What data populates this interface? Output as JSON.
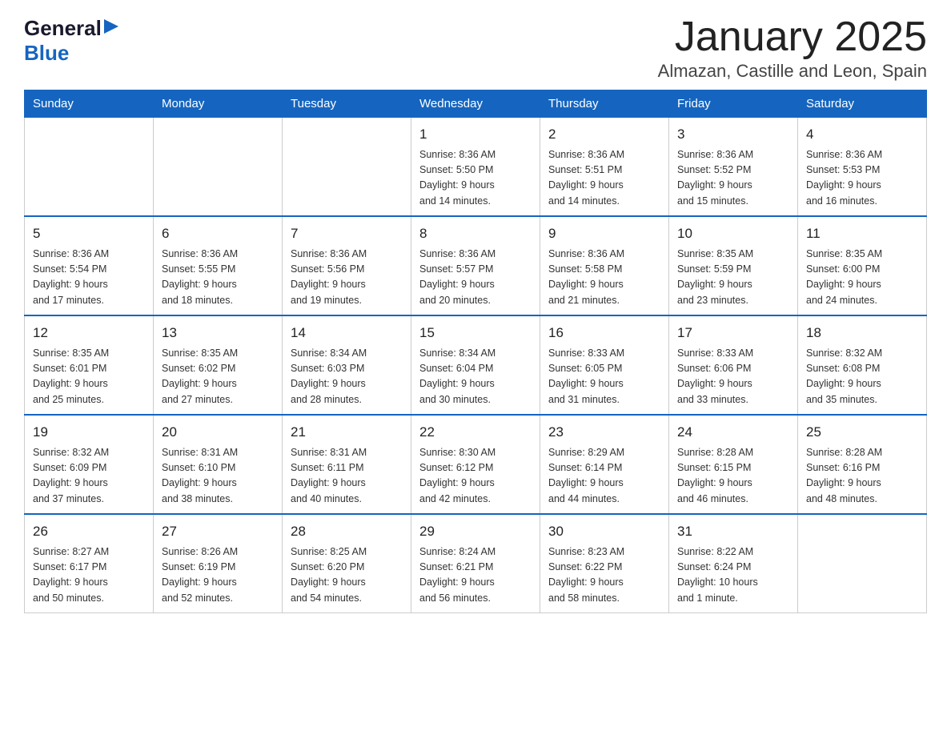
{
  "header": {
    "logo_general": "General",
    "logo_blue": "Blue",
    "month_title": "January 2025",
    "location": "Almazan, Castille and Leon, Spain"
  },
  "days_of_week": [
    "Sunday",
    "Monday",
    "Tuesday",
    "Wednesday",
    "Thursday",
    "Friday",
    "Saturday"
  ],
  "weeks": [
    [
      {
        "day": "",
        "info": ""
      },
      {
        "day": "",
        "info": ""
      },
      {
        "day": "",
        "info": ""
      },
      {
        "day": "1",
        "info": "Sunrise: 8:36 AM\nSunset: 5:50 PM\nDaylight: 9 hours\nand 14 minutes."
      },
      {
        "day": "2",
        "info": "Sunrise: 8:36 AM\nSunset: 5:51 PM\nDaylight: 9 hours\nand 14 minutes."
      },
      {
        "day": "3",
        "info": "Sunrise: 8:36 AM\nSunset: 5:52 PM\nDaylight: 9 hours\nand 15 minutes."
      },
      {
        "day": "4",
        "info": "Sunrise: 8:36 AM\nSunset: 5:53 PM\nDaylight: 9 hours\nand 16 minutes."
      }
    ],
    [
      {
        "day": "5",
        "info": "Sunrise: 8:36 AM\nSunset: 5:54 PM\nDaylight: 9 hours\nand 17 minutes."
      },
      {
        "day": "6",
        "info": "Sunrise: 8:36 AM\nSunset: 5:55 PM\nDaylight: 9 hours\nand 18 minutes."
      },
      {
        "day": "7",
        "info": "Sunrise: 8:36 AM\nSunset: 5:56 PM\nDaylight: 9 hours\nand 19 minutes."
      },
      {
        "day": "8",
        "info": "Sunrise: 8:36 AM\nSunset: 5:57 PM\nDaylight: 9 hours\nand 20 minutes."
      },
      {
        "day": "9",
        "info": "Sunrise: 8:36 AM\nSunset: 5:58 PM\nDaylight: 9 hours\nand 21 minutes."
      },
      {
        "day": "10",
        "info": "Sunrise: 8:35 AM\nSunset: 5:59 PM\nDaylight: 9 hours\nand 23 minutes."
      },
      {
        "day": "11",
        "info": "Sunrise: 8:35 AM\nSunset: 6:00 PM\nDaylight: 9 hours\nand 24 minutes."
      }
    ],
    [
      {
        "day": "12",
        "info": "Sunrise: 8:35 AM\nSunset: 6:01 PM\nDaylight: 9 hours\nand 25 minutes."
      },
      {
        "day": "13",
        "info": "Sunrise: 8:35 AM\nSunset: 6:02 PM\nDaylight: 9 hours\nand 27 minutes."
      },
      {
        "day": "14",
        "info": "Sunrise: 8:34 AM\nSunset: 6:03 PM\nDaylight: 9 hours\nand 28 minutes."
      },
      {
        "day": "15",
        "info": "Sunrise: 8:34 AM\nSunset: 6:04 PM\nDaylight: 9 hours\nand 30 minutes."
      },
      {
        "day": "16",
        "info": "Sunrise: 8:33 AM\nSunset: 6:05 PM\nDaylight: 9 hours\nand 31 minutes."
      },
      {
        "day": "17",
        "info": "Sunrise: 8:33 AM\nSunset: 6:06 PM\nDaylight: 9 hours\nand 33 minutes."
      },
      {
        "day": "18",
        "info": "Sunrise: 8:32 AM\nSunset: 6:08 PM\nDaylight: 9 hours\nand 35 minutes."
      }
    ],
    [
      {
        "day": "19",
        "info": "Sunrise: 8:32 AM\nSunset: 6:09 PM\nDaylight: 9 hours\nand 37 minutes."
      },
      {
        "day": "20",
        "info": "Sunrise: 8:31 AM\nSunset: 6:10 PM\nDaylight: 9 hours\nand 38 minutes."
      },
      {
        "day": "21",
        "info": "Sunrise: 8:31 AM\nSunset: 6:11 PM\nDaylight: 9 hours\nand 40 minutes."
      },
      {
        "day": "22",
        "info": "Sunrise: 8:30 AM\nSunset: 6:12 PM\nDaylight: 9 hours\nand 42 minutes."
      },
      {
        "day": "23",
        "info": "Sunrise: 8:29 AM\nSunset: 6:14 PM\nDaylight: 9 hours\nand 44 minutes."
      },
      {
        "day": "24",
        "info": "Sunrise: 8:28 AM\nSunset: 6:15 PM\nDaylight: 9 hours\nand 46 minutes."
      },
      {
        "day": "25",
        "info": "Sunrise: 8:28 AM\nSunset: 6:16 PM\nDaylight: 9 hours\nand 48 minutes."
      }
    ],
    [
      {
        "day": "26",
        "info": "Sunrise: 8:27 AM\nSunset: 6:17 PM\nDaylight: 9 hours\nand 50 minutes."
      },
      {
        "day": "27",
        "info": "Sunrise: 8:26 AM\nSunset: 6:19 PM\nDaylight: 9 hours\nand 52 minutes."
      },
      {
        "day": "28",
        "info": "Sunrise: 8:25 AM\nSunset: 6:20 PM\nDaylight: 9 hours\nand 54 minutes."
      },
      {
        "day": "29",
        "info": "Sunrise: 8:24 AM\nSunset: 6:21 PM\nDaylight: 9 hours\nand 56 minutes."
      },
      {
        "day": "30",
        "info": "Sunrise: 8:23 AM\nSunset: 6:22 PM\nDaylight: 9 hours\nand 58 minutes."
      },
      {
        "day": "31",
        "info": "Sunrise: 8:22 AM\nSunset: 6:24 PM\nDaylight: 10 hours\nand 1 minute."
      },
      {
        "day": "",
        "info": ""
      }
    ]
  ]
}
